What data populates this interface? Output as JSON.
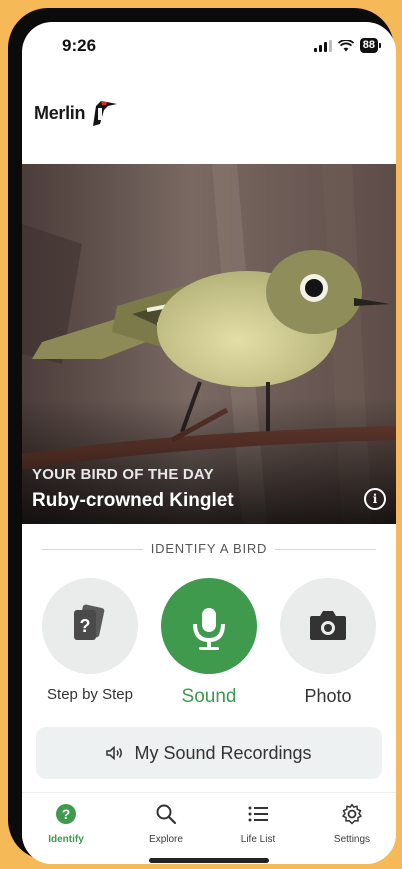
{
  "status_bar": {
    "time": "9:26",
    "battery": "88"
  },
  "app": {
    "logo_text": "Merlin"
  },
  "hero": {
    "label": "YOUR BIRD OF THE DAY",
    "bird_name": "Ruby-crowned Kinglet",
    "info_icon": "info-icon"
  },
  "identify": {
    "title": "IDENTIFY A BIRD",
    "buttons": [
      {
        "label": "Step by Step",
        "icon": "cards-question-icon"
      },
      {
        "label": "Sound",
        "icon": "microphone-icon"
      },
      {
        "label": "Photo",
        "icon": "camera-icon"
      }
    ]
  },
  "recordings": {
    "label": "My Sound Recordings",
    "icon": "speaker-icon"
  },
  "tabs": [
    {
      "label": "Identify",
      "icon": "question-circle-icon",
      "active": true
    },
    {
      "label": "Explore",
      "icon": "search-icon"
    },
    {
      "label": "Life List",
      "icon": "list-icon"
    },
    {
      "label": "Settings",
      "icon": "gear-icon"
    }
  ],
  "colors": {
    "accent": "#3f9a4d",
    "background": "#f6b957"
  }
}
